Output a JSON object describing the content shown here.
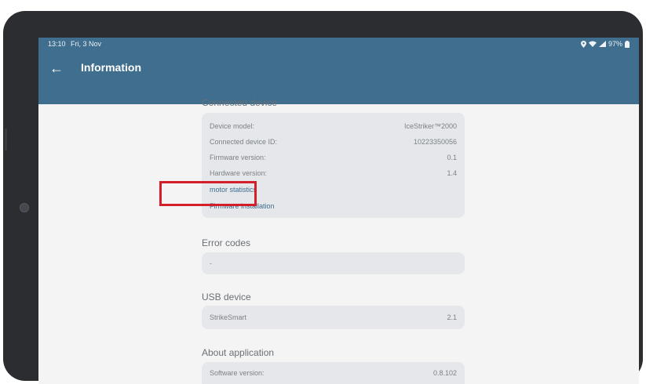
{
  "status_bar": {
    "time": "13:10",
    "date": "Fri, 3 Nov",
    "battery": "97%",
    "icons": [
      "location-icon",
      "wifi-icon",
      "signal-icon",
      "battery-icon"
    ]
  },
  "app_bar": {
    "title": "Information",
    "back_icon": "back-arrow-icon",
    "color": "#3f6e8e"
  },
  "connected_device": {
    "title": "Connected device",
    "rows": [
      {
        "label": "Device model:",
        "value": "IceStriker™2000"
      },
      {
        "label": "Connected device ID:",
        "value": "10223350056"
      },
      {
        "label": "Firmware version:",
        "value": "0.1"
      },
      {
        "label": "Hardware version:",
        "value": "1.4"
      }
    ],
    "links": {
      "motor_statistics": "motor statistics",
      "firmware_installation": "Firmware installation"
    }
  },
  "error_codes": {
    "title": "Error codes",
    "value": "-"
  },
  "usb_device": {
    "title": "USB device",
    "label": "StrikeSmart",
    "value": "2.1"
  },
  "about_application": {
    "title": "About application",
    "label": "Software version:",
    "value": "0.8.102"
  },
  "highlight_color": "#d31f2a"
}
